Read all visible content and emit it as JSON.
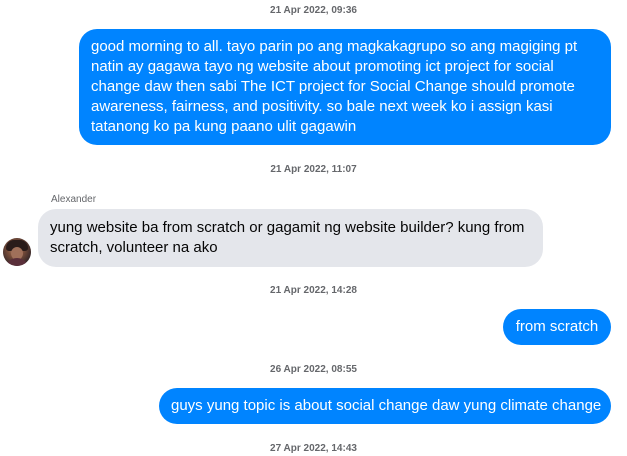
{
  "timestamps": {
    "t1": "21 Apr 2022, 09:36",
    "t2": "21 Apr 2022, 11:07",
    "t3": "21 Apr 2022, 14:28",
    "t4": "26 Apr 2022, 08:55",
    "t5": "27 Apr 2022, 14:43"
  },
  "messages": {
    "m1": "good morning to all. tayo parin po ang magkakagrupo so ang magiging pt natin ay gagawa tayo ng website about promoting ict project for  social change daw then sabi The ICT project for Social Change should promote awareness, fairness, and positivity. so bale next week ko i assign kasi tatanong ko pa kung paano ulit gagawin",
    "m2_sender": "Alexander",
    "m2": "yung website ba from scratch or gagamit ng website builder? kung from scratch, volunteer na ako",
    "m3": "from scratch",
    "m4": "guys yung topic is about social change daw yung climate change"
  },
  "colors": {
    "outgoing_bubble": "#0084ff",
    "incoming_bubble": "#e4e6eb",
    "timestamp_text": "#65676b"
  }
}
